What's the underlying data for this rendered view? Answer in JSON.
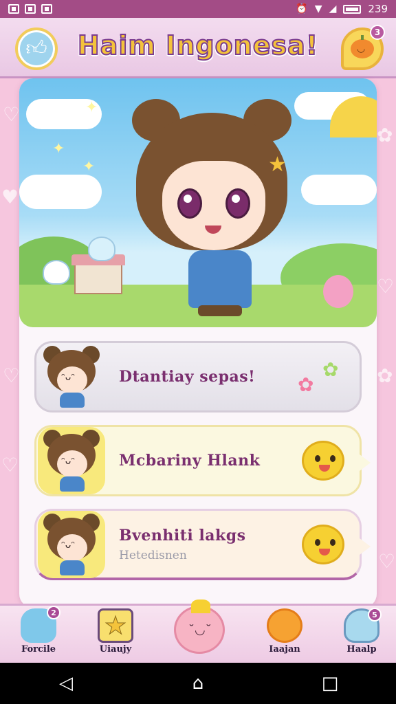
{
  "status_bar": {
    "time": "239"
  },
  "header": {
    "title": "Haim Ingonesa!",
    "profile_badge": "3"
  },
  "actions": [
    {
      "label": "Dtantiay sepas!",
      "sub": ""
    },
    {
      "label": "Mcbariny Hlank",
      "sub": ""
    },
    {
      "label": "Bvenhiti lakgs",
      "sub": "Hetedisnen"
    }
  ],
  "bottom_nav": [
    {
      "label": "Forcile",
      "badge": "2"
    },
    {
      "label": "Uiaujy",
      "badge": ""
    },
    {
      "label": "",
      "badge": ""
    },
    {
      "label": "Iaajan",
      "badge": ""
    },
    {
      "label": "Haalp",
      "badge": "5"
    }
  ]
}
